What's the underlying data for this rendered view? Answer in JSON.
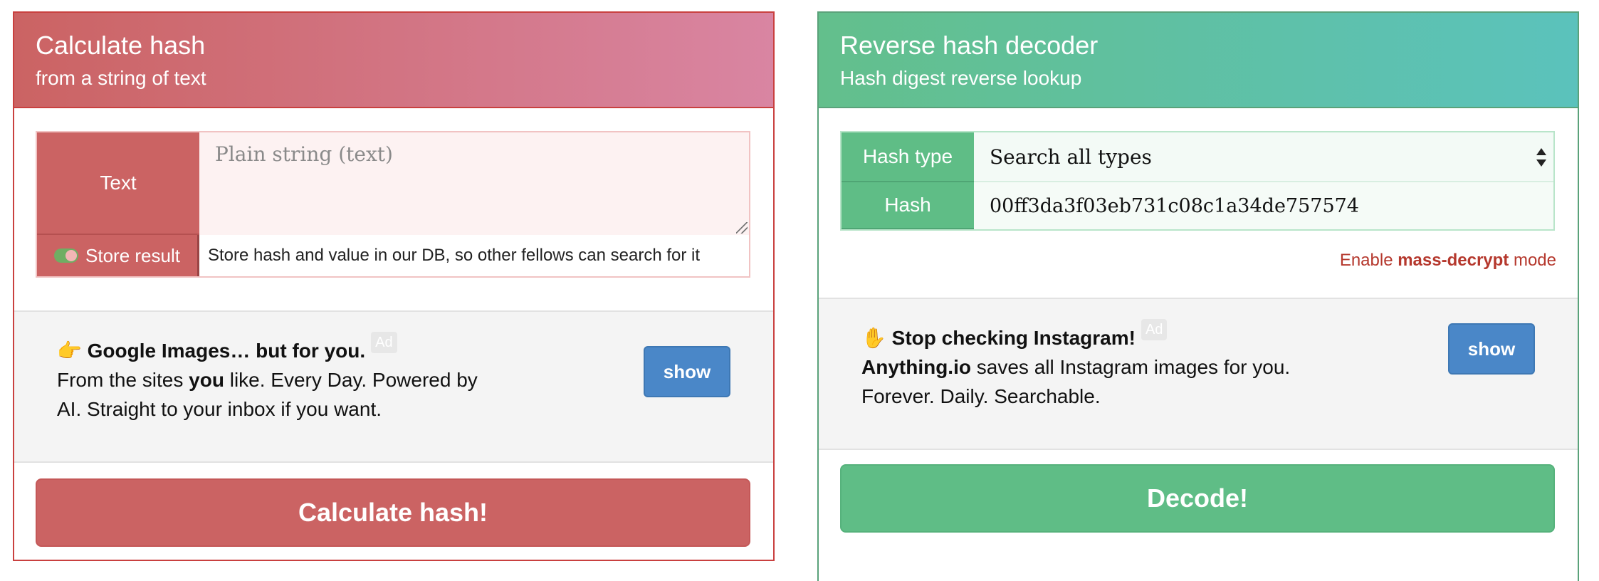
{
  "left_panel": {
    "title": "Calculate hash",
    "subtitle": "from a string of text",
    "text_label": "Text",
    "text_placeholder": "Plain string (text)",
    "store_label": "Store result",
    "store_description": "Store hash and value in our DB, so other fellows can search for it",
    "ad": {
      "emoji": "👉",
      "headline": "Google Images… but for you.",
      "tag": "Ad",
      "line1_pre": "From the sites ",
      "line1_bold": "you",
      "line1_post": " like. Every Day. Powered by",
      "line2": "AI. Straight to your inbox if you want.",
      "show_label": "show"
    },
    "calculate_label": "Calculate hash!"
  },
  "right_panel": {
    "title": "Reverse hash decoder",
    "subtitle": "Hash digest reverse lookup",
    "hash_type_label": "Hash type",
    "hash_type_value": "Search all types",
    "hash_label": "Hash",
    "hash_value": "00ff3da3f03eb731c08c1a34de757574",
    "mass_pre": "Enable ",
    "mass_bold": "mass-decrypt",
    "mass_post": " mode",
    "ad": {
      "emoji": "✋",
      "headline": "Stop checking Instagram!",
      "tag": "Ad",
      "line1_bold": "Anything.io",
      "line1_post": " saves all Instagram images for you.",
      "line2": "Forever. Daily. Searchable.",
      "show_label": "show"
    },
    "decode_label": "Decode!"
  },
  "colors": {
    "calc_red": "#cb6363",
    "decode_green": "#5fbd86",
    "show_blue": "#4a87c8",
    "mass_red": "#b5382d"
  },
  "icons": [
    "toggle-switch-icon",
    "resize-handle-icon",
    "select-arrows-icon"
  ]
}
